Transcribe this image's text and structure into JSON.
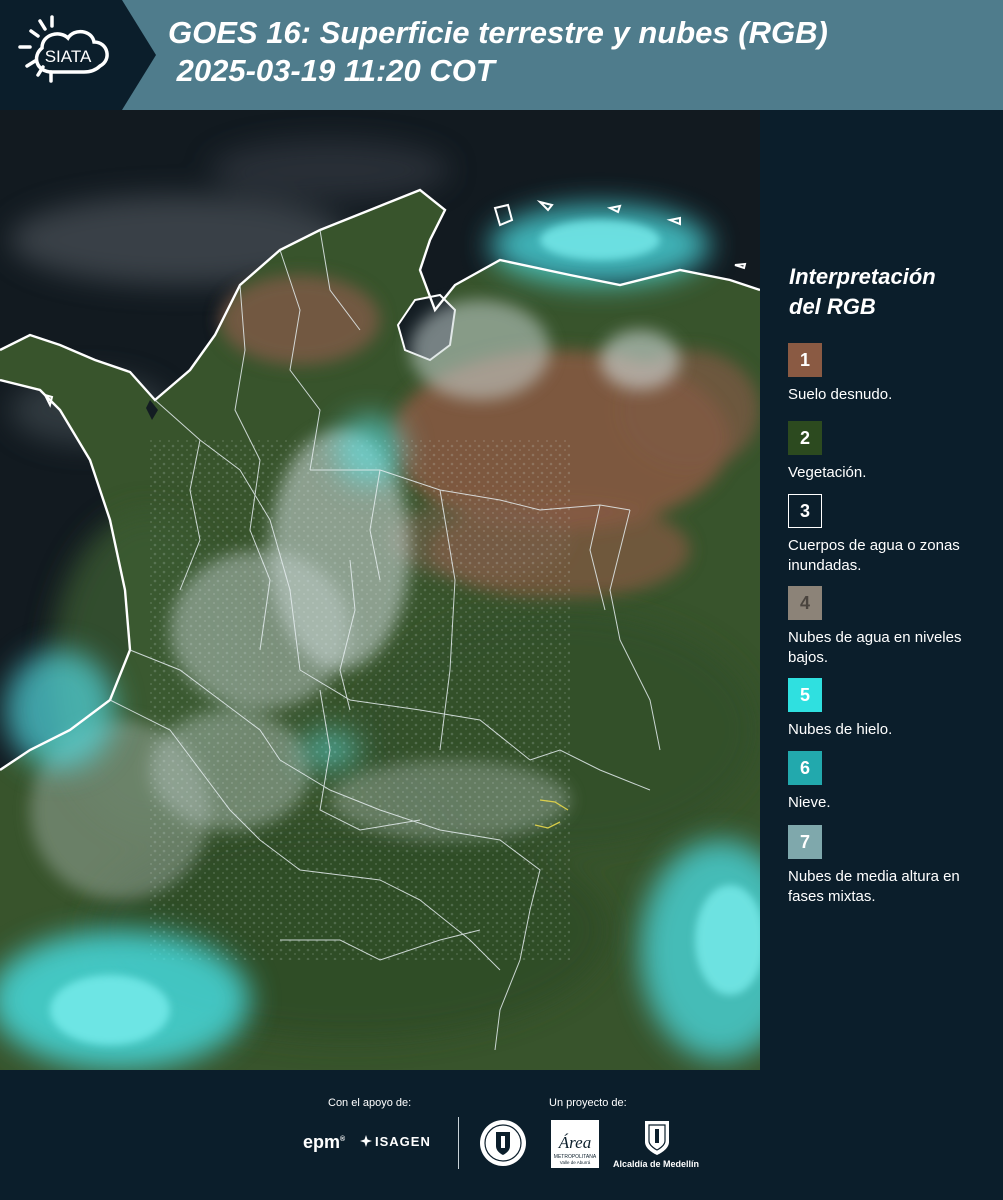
{
  "header": {
    "logo_text": "SIATA",
    "title_line1": "GOES 16: Superficie terrestre y nubes (RGB)",
    "title_line2": " 2025-03-19 11:20 COT"
  },
  "legend": {
    "title_line1": "Interpretación",
    "title_line2": "del RGB",
    "items": [
      {
        "num": "1",
        "label": "Suelo desnudo.",
        "color": "#8a5a43"
      },
      {
        "num": "2",
        "label": "Vegetación.",
        "color": "#2c4a1f"
      },
      {
        "num": "3",
        "label": "Cuerpos de agua o zonas inundadas.",
        "color": "#0b1e2b"
      },
      {
        "num": "4",
        "label": "Nubes de agua en niveles bajos.",
        "color": "#8c8378"
      },
      {
        "num": "5",
        "label": "Nubes de hielo.",
        "color": "#2fe0e0"
      },
      {
        "num": "6",
        "label": "Nieve.",
        "color": "#22a9ad"
      },
      {
        "num": "7",
        "label": "Nubes de media altura en fases mixtas.",
        "color": "#7fa8ac"
      }
    ]
  },
  "footer": {
    "support_label": "Con el apoyo de:",
    "project_label": "Un proyecto de:",
    "epm": "epm",
    "isagen": "ISAGEN",
    "area_text": "Área",
    "area_sub1": "METROPOLITANA",
    "area_sub2": "Valle de Aburrá",
    "alcaldia": "Alcaldía de Medellín"
  }
}
